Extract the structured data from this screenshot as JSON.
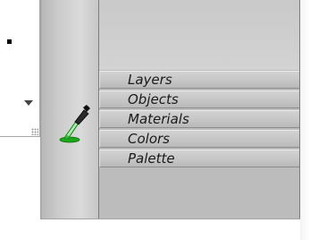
{
  "panel": {
    "tabs": [
      {
        "label": "Layers"
      },
      {
        "label": "Objects"
      },
      {
        "label": "Materials"
      },
      {
        "label": "Colors"
      },
      {
        "label": "Palette"
      }
    ]
  },
  "tool": {
    "icon": "eyedropper-icon",
    "accent_color": "#22c022"
  },
  "colors": {
    "panel_bg": "#bcbcbc",
    "tab_text": "#1a1a1a",
    "background": "#ffffff"
  }
}
